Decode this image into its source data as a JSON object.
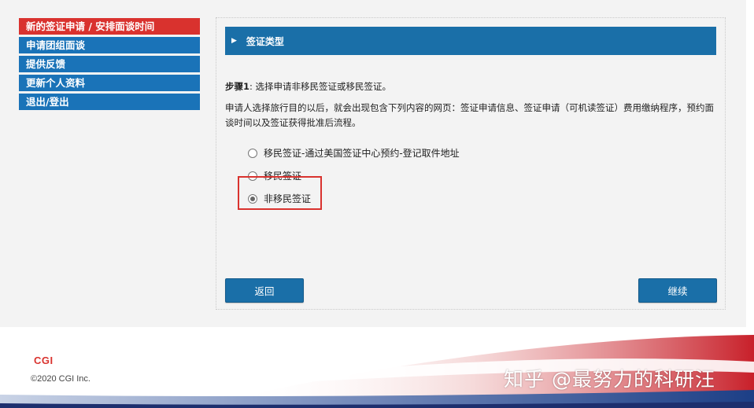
{
  "sidebar": {
    "items": [
      {
        "label": "新的签证申请 / 安排面谈时间",
        "active": true
      },
      {
        "label": "申请团组面谈",
        "active": false
      },
      {
        "label": "提供反馈",
        "active": false
      },
      {
        "label": "更新个人资料",
        "active": false
      },
      {
        "label": "退出/登出",
        "active": false
      }
    ]
  },
  "panel": {
    "header_title": "签证类型",
    "step_label": "步骤1",
    "step_text": ": 选择申请非移民签证或移民签证。",
    "description": "申请人选择旅行目的以后，就会出现包含下列内容的网页：签证申请信息、签证申请（可机读签证）费用缴纳程序，预约面谈时间以及签证获得批准后流程。",
    "options": [
      {
        "label": "移民签证-通过美国签证中心预约-登记取件地址",
        "selected": false
      },
      {
        "label": "移民签证",
        "selected": false
      },
      {
        "label": "非移民签证",
        "selected": true
      }
    ],
    "back_button": "返回",
    "continue_button": "继续"
  },
  "footer": {
    "logo": "CGI",
    "copyright": "©2020 CGI Inc.",
    "watermark": "知乎 @最努力的科研汪"
  },
  "colors": {
    "accent_blue": "#1a6fa8",
    "active_red": "#d9322e"
  }
}
